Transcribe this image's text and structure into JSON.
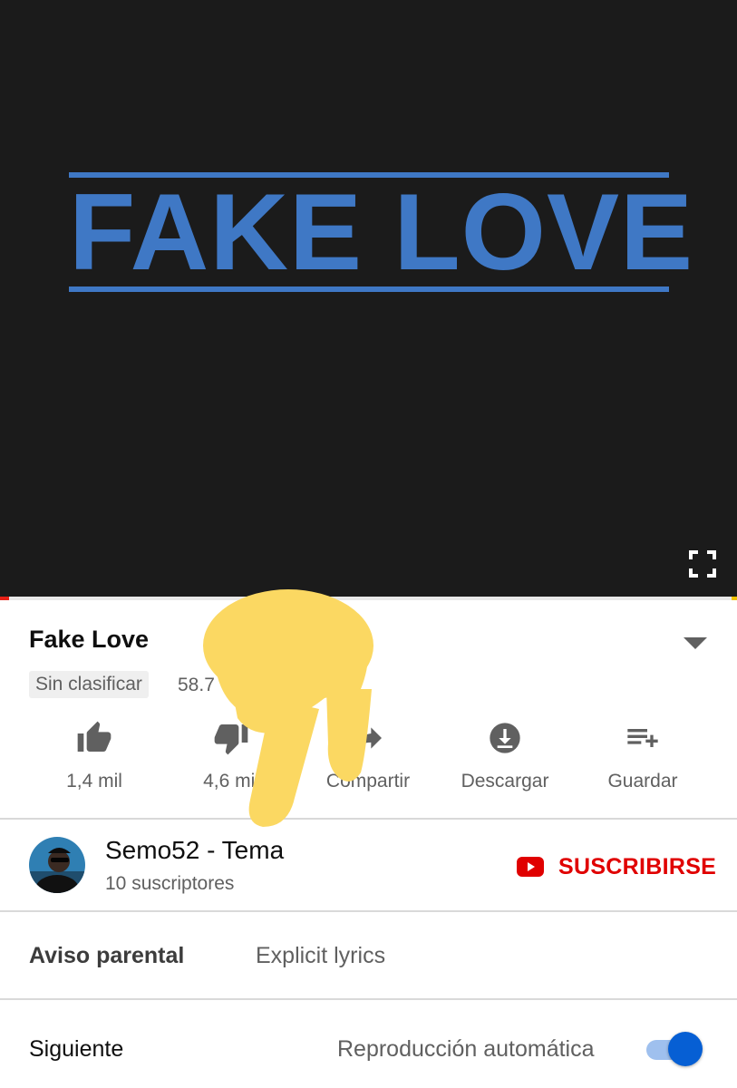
{
  "player": {
    "thumbnail_text": "FAKE LOVE",
    "progress_fraction": 0.012,
    "fullscreen_icon": "fullscreen-icon"
  },
  "video": {
    "title": "Fake Love",
    "badge": "Sin clasificar",
    "views": "58.7                   es",
    "expand_icon": "chevron-down-icon"
  },
  "actions": [
    {
      "icon": "thumbs-up-icon",
      "label": "1,4 mil"
    },
    {
      "icon": "thumbs-down-icon",
      "label": "4,6 mil"
    },
    {
      "icon": "share-icon",
      "label": "Compartir"
    },
    {
      "icon": "download-icon",
      "label": "Descargar"
    },
    {
      "icon": "playlist-add-icon",
      "label": "Guardar"
    }
  ],
  "channel": {
    "name": "Semo52 - Tema",
    "subscribers": "10 suscriptores",
    "subscribe_label": "SUSCRIBIRSE"
  },
  "advisory": {
    "label": "Aviso parental",
    "value": "Explicit lyrics"
  },
  "up_next": {
    "label": "Siguiente",
    "autoplay_label": "Reproducción automática",
    "autoplay_on": true
  },
  "colors": {
    "thumbnail_blue": "#3f78c5",
    "subscribe_red": "#e00000",
    "toggle_blue": "#065fd4",
    "overlay_yellow": "#fbd862"
  }
}
